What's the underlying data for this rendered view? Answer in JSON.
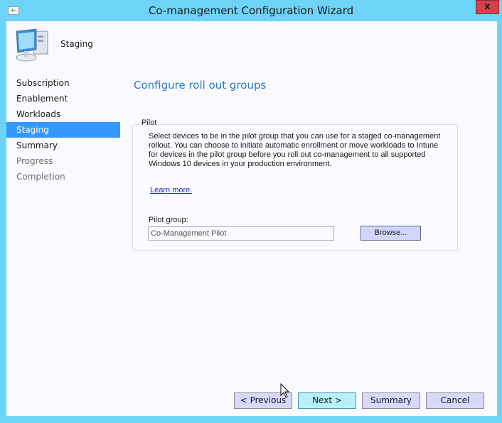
{
  "window": {
    "title": "Co-management Configuration Wizard",
    "close_label": "x",
    "system_icon": "window-menu-icon"
  },
  "header": {
    "icon": "computer-icon",
    "title": "Staging"
  },
  "nav": {
    "items": [
      {
        "label": "Subscription",
        "state": "normal"
      },
      {
        "label": "Enablement",
        "state": "normal"
      },
      {
        "label": "Workloads",
        "state": "normal"
      },
      {
        "label": "Staging",
        "state": "active"
      },
      {
        "label": "Summary",
        "state": "normal"
      },
      {
        "label": "Progress",
        "state": "disabled"
      },
      {
        "label": "Completion",
        "state": "disabled"
      }
    ]
  },
  "main": {
    "heading": "Configure roll out groups",
    "pilot": {
      "legend": "Pilot",
      "description": "Select devices to be in the pilot group that you can use for a staged co-management rollout. You can choose to initiate automatic enrollment or move workloads to Intune for devices in the pilot group before you roll out co-management to all supported Windows 10 devices in your production environment.",
      "learn_more": "Learn more.",
      "group_label": "Pilot group:",
      "group_value": "Co-Management Pilot",
      "browse_label": "Browse..."
    }
  },
  "footer": {
    "previous_label": "< Previous",
    "next_label": "Next >",
    "summary_label": "Summary",
    "cancel_label": "Cancel"
  },
  "colors": {
    "frame": "#6dd3f7",
    "close": "#d4414d",
    "nav_active": "#3399ff",
    "heading": "#2b7aba",
    "button": "#d9d8fb",
    "primary_button": "#b8f1fb"
  }
}
